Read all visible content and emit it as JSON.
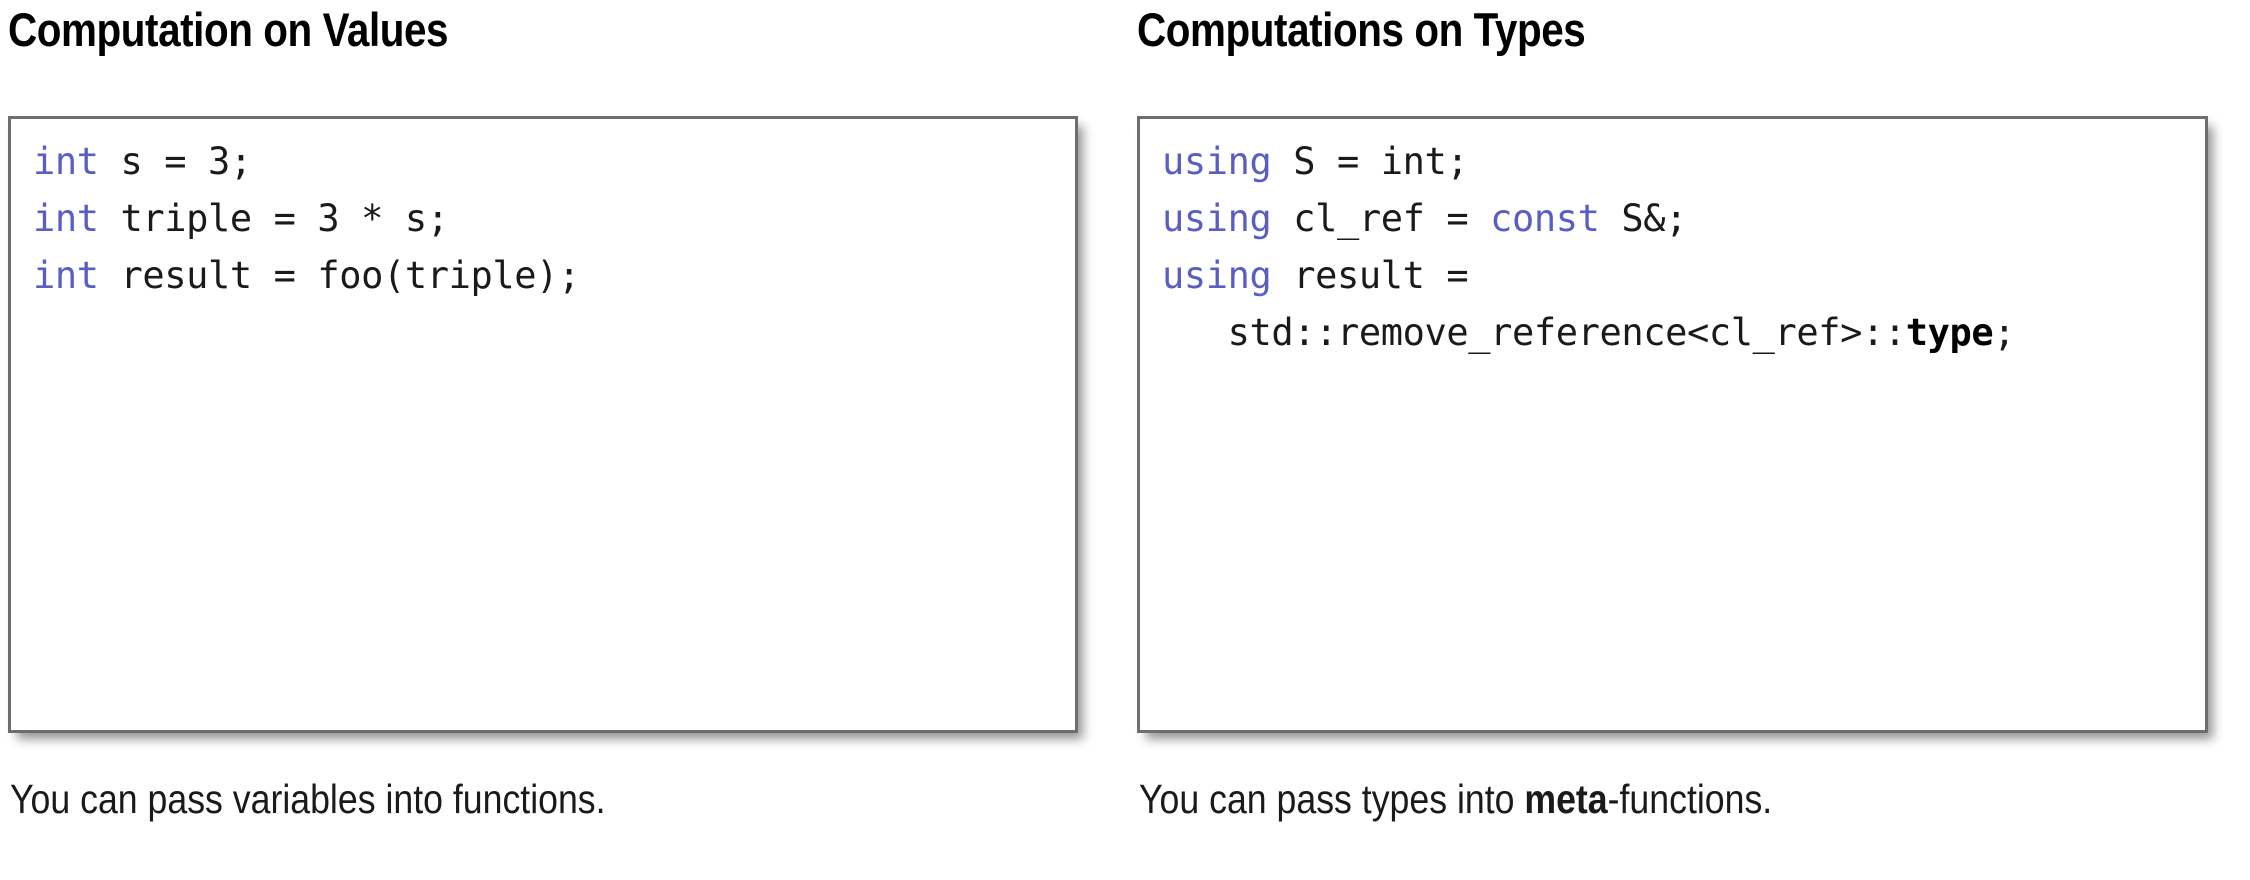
{
  "panels": [
    {
      "id": "values",
      "title": "Computation on Values",
      "code_lines": [
        [
          {
            "t": "int",
            "style": "kw"
          },
          {
            "t": " s = 3;",
            "style": "plain"
          }
        ],
        [
          {
            "t": "int",
            "style": "kw"
          },
          {
            "t": " triple = 3 * s;",
            "style": "plain"
          }
        ],
        [
          {
            "t": "int",
            "style": "kw"
          },
          {
            "t": " result = foo(triple);",
            "style": "plain"
          }
        ]
      ],
      "caption": [
        {
          "t": "You can pass variables into functions.",
          "style": "plain"
        }
      ]
    },
    {
      "id": "types",
      "title": "Computations on Types",
      "code_lines": [
        [
          {
            "t": "using",
            "style": "kw"
          },
          {
            "t": " S = int;",
            "style": "plain"
          }
        ],
        [
          {
            "t": "using",
            "style": "kw"
          },
          {
            "t": " cl_ref = ",
            "style": "plain"
          },
          {
            "t": "const",
            "style": "kw"
          },
          {
            "t": " S&;",
            "style": "plain"
          }
        ],
        [
          {
            "t": "using",
            "style": "kw"
          },
          {
            "t": " result =",
            "style": "plain"
          }
        ],
        [
          {
            "t": "   std::remove_reference<cl_ref>::",
            "style": "plain"
          },
          {
            "t": "type",
            "style": "bold"
          },
          {
            "t": ";",
            "style": "plain"
          }
        ]
      ],
      "caption": [
        {
          "t": "You can pass types into ",
          "style": "plain"
        },
        {
          "t": "meta",
          "style": "bold"
        },
        {
          "t": "-functions.",
          "style": "plain"
        }
      ]
    }
  ],
  "colors": {
    "keyword": "#5a5ec2",
    "text": "#1a1a1a",
    "box_border": "#6e6e6e",
    "background": "#ffffff"
  }
}
